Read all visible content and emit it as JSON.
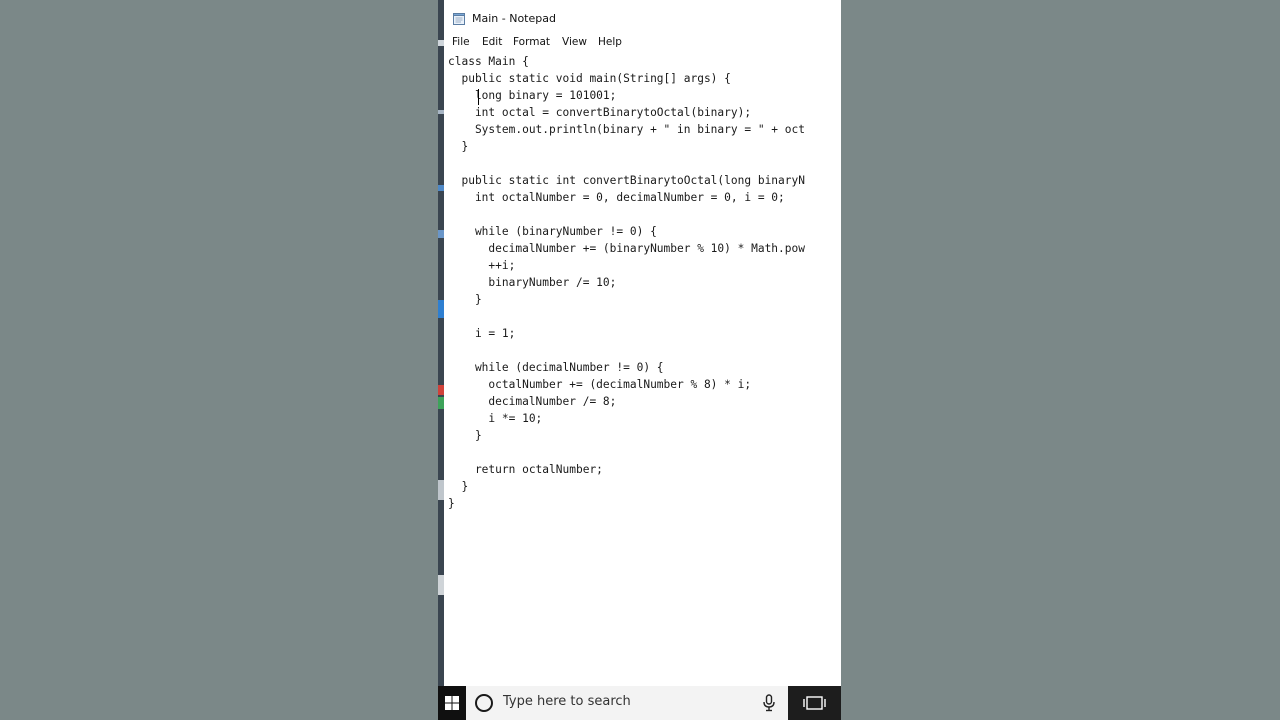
{
  "window": {
    "title": "Main - Notepad"
  },
  "menu": {
    "file": "File",
    "edit": "Edit",
    "format": "Format",
    "view": "View",
    "help": "Help"
  },
  "editor": {
    "lines": [
      "class Main {",
      "  public static void main(String[] args) {",
      "    long binary = 101001;",
      "    int octal = convertBinarytoOctal(binary);",
      "    System.out.println(binary + \" in binary = \" + oct",
      "  }",
      "",
      "  public static int convertBinarytoOctal(long binaryN",
      "    int octalNumber = 0, decimalNumber = 0, i = 0;",
      "",
      "    while (binaryNumber != 0) {",
      "      decimalNumber += (binaryNumber % 10) * Math.pow",
      "      ++i;",
      "      binaryNumber /= 10;",
      "    }",
      "",
      "    i = 1;",
      "",
      "    while (decimalNumber != 0) {",
      "      octalNumber += (decimalNumber % 8) * i;",
      "      decimalNumber /= 8;",
      "      i *= 10;",
      "    }",
      "",
      "    return octalNumber;",
      "  }",
      "}"
    ]
  },
  "taskbar": {
    "search_placeholder": "Type here to search",
    "start_icon": "windows-logo-icon",
    "search_icon": "cortana-circle-icon",
    "mic_icon": "microphone-icon",
    "taskview_icon": "task-view-icon"
  },
  "colors": {
    "background": "#7b8888",
    "window": "#ffffff",
    "taskbar": "#1d1d1d",
    "search_box": "#f3f3f3"
  }
}
